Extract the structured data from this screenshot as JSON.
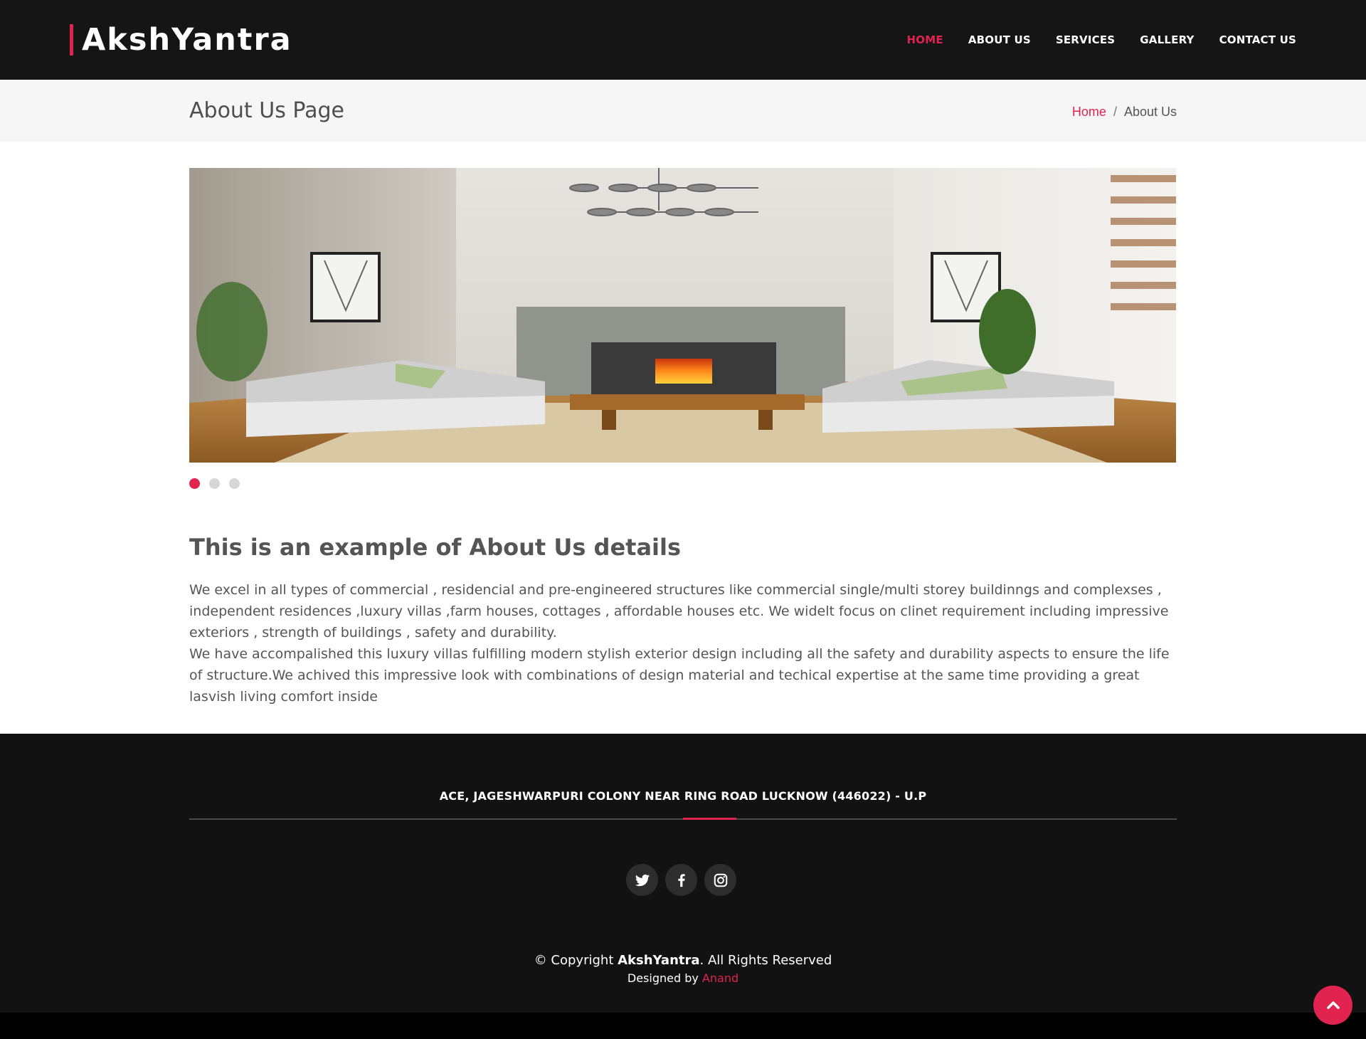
{
  "header": {
    "logo": "AkshYantra",
    "nav": [
      "HOME",
      "ABOUT US",
      "SERVICES",
      "GALLERY",
      "CONTACT US"
    ],
    "active_nav": "HOME"
  },
  "breadcrumb": {
    "page_title": "About Us Page",
    "home": "Home",
    "separator": "/",
    "current": "About Us"
  },
  "slider": {
    "image": "living-room-interior",
    "total_slides": 3,
    "active_slide": 1
  },
  "about": {
    "title": "This is an example of About Us details",
    "paragraph_1": "We excel in all types of commercial , residencial and pre-engineered structures like commercial single/multi storey buildinngs and complexses , independent residences ,luxury villas ,farm houses, cottages , affordable houses etc. We widelt focus on clinet requirement including impressive exteriors , strength of buildings , safety and durability.",
    "paragraph_2": "We have accompalished this luxury villas fulfilling modern stylish exterior design including all the safety and durability aspects to ensure the life of structure.We achived this impressive look with combinations of design material and techical expertise at the same time providing a great lasvish living comfort inside"
  },
  "footer": {
    "address": "ACE, JAGESHWARPURI COLONY NEAR RING ROAD LUCKNOW (446022) - U.P",
    "socials": [
      "twitter-icon",
      "facebook-icon",
      "instagram-icon"
    ],
    "copyright_prefix": "© Copyright ",
    "copyright_brand": "AkshYantra",
    "copyright_suffix": ". All Rights Reserved",
    "designed_by": "Designed by ",
    "designer": "Anand"
  },
  "colors": {
    "accent": "#e0234f",
    "header_bg": "#151515",
    "footer_bg": "#121212",
    "crumb_bg": "#f6f6f6",
    "text": "#555555"
  }
}
